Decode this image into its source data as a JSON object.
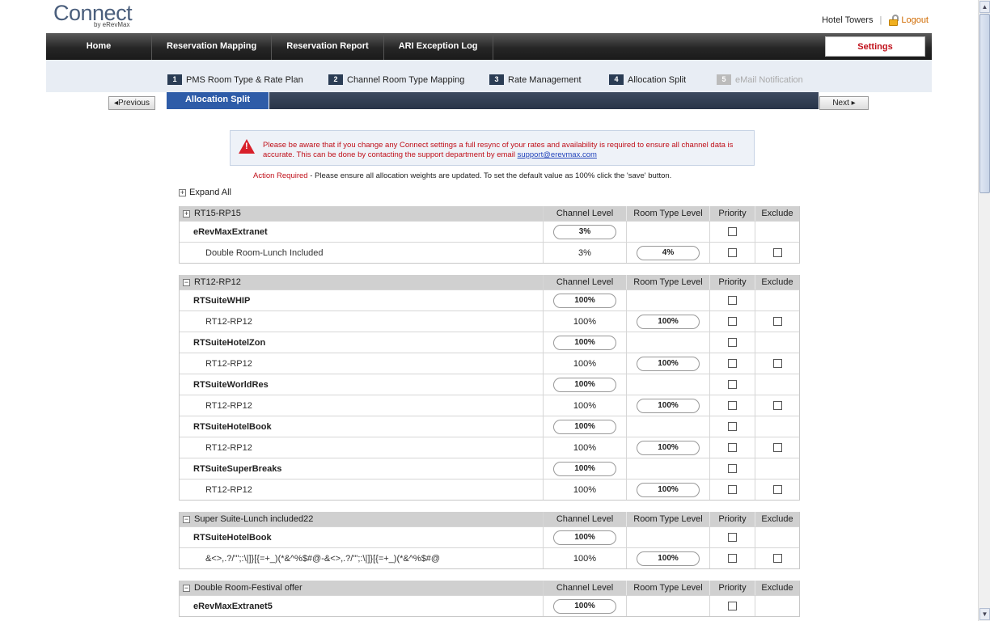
{
  "brand": {
    "name": "Connect",
    "sub": "by eRevMax"
  },
  "header": {
    "hotel": "Hotel Towers",
    "separator": "|",
    "logout": "Logout"
  },
  "nav": {
    "items": [
      "Home",
      "Reservation Mapping",
      "Reservation Report",
      "ARI Exception Log"
    ],
    "settings": "Settings"
  },
  "steps": [
    {
      "num": "1",
      "label": "PMS Room Type & Rate Plan"
    },
    {
      "num": "2",
      "label": "Channel Room Type Mapping"
    },
    {
      "num": "3",
      "label": "Rate Management"
    },
    {
      "num": "4",
      "label": "Allocation Split"
    },
    {
      "num": "5",
      "label": "eMail Notification"
    }
  ],
  "subtab": "Allocation Split",
  "previous": "◂Previous",
  "next": "Next ▸",
  "notice": {
    "text": "Please be aware that if you change any Connect settings a full resync of your rates and availability is required to ensure all channel data is accurate. This can be done by contacting the support department by email ",
    "email": "support@erevmax.com"
  },
  "action": {
    "prefix": "Action Required",
    "text": " - Please ensure all allocation weights are updated. To set the default value as 100% click the 'save' button."
  },
  "expand_all": "Expand All",
  "columns": {
    "channel": "Channel Level",
    "room": "Room Type Level",
    "priority": "Priority",
    "exclude": "Exclude"
  },
  "groups": [
    {
      "title": "RT15-RP15",
      "toggle": "+",
      "rows": [
        {
          "name": "eRevMaxExtranet",
          "channel": "3%"
        },
        {
          "name": "Double Room-Lunch Included",
          "channel": "3%",
          "room": "4%"
        }
      ]
    },
    {
      "title": "RT12-RP12",
      "toggle": "−",
      "rows": [
        {
          "name": "RTSuiteWHIP",
          "channel": "100%"
        },
        {
          "name": "RT12-RP12",
          "channel": "100%",
          "room": "100%"
        },
        {
          "name": "RTSuiteHotelZon",
          "channel": "100%"
        },
        {
          "name": "RT12-RP12",
          "channel": "100%",
          "room": "100%"
        },
        {
          "name": "RTSuiteWorldRes",
          "channel": "100%"
        },
        {
          "name": "RT12-RP12",
          "channel": "100%",
          "room": "100%"
        },
        {
          "name": "RTSuiteHotelBook",
          "channel": "100%"
        },
        {
          "name": "RT12-RP12",
          "channel": "100%",
          "room": "100%"
        },
        {
          "name": "RTSuiteSuperBreaks",
          "channel": "100%"
        },
        {
          "name": "RT12-RP12",
          "channel": "100%",
          "room": "100%"
        }
      ]
    },
    {
      "title": "Super Suite-Lunch included22",
      "toggle": "−",
      "rows": [
        {
          "name": "RTSuiteHotelBook",
          "channel": "100%"
        },
        {
          "name": "&<>,.?/\"';:\\|]}[{=+_)(*&^%$#@-&<>,.?/\"';:\\|]}[{=+_)(*&^%$#@",
          "channel": "100%",
          "room": "100%"
        }
      ]
    },
    {
      "title": "Double Room-Festival offer",
      "toggle": "−",
      "rows": [
        {
          "name": "eRevMaxExtranet5",
          "channel": "100%"
        }
      ]
    }
  ]
}
